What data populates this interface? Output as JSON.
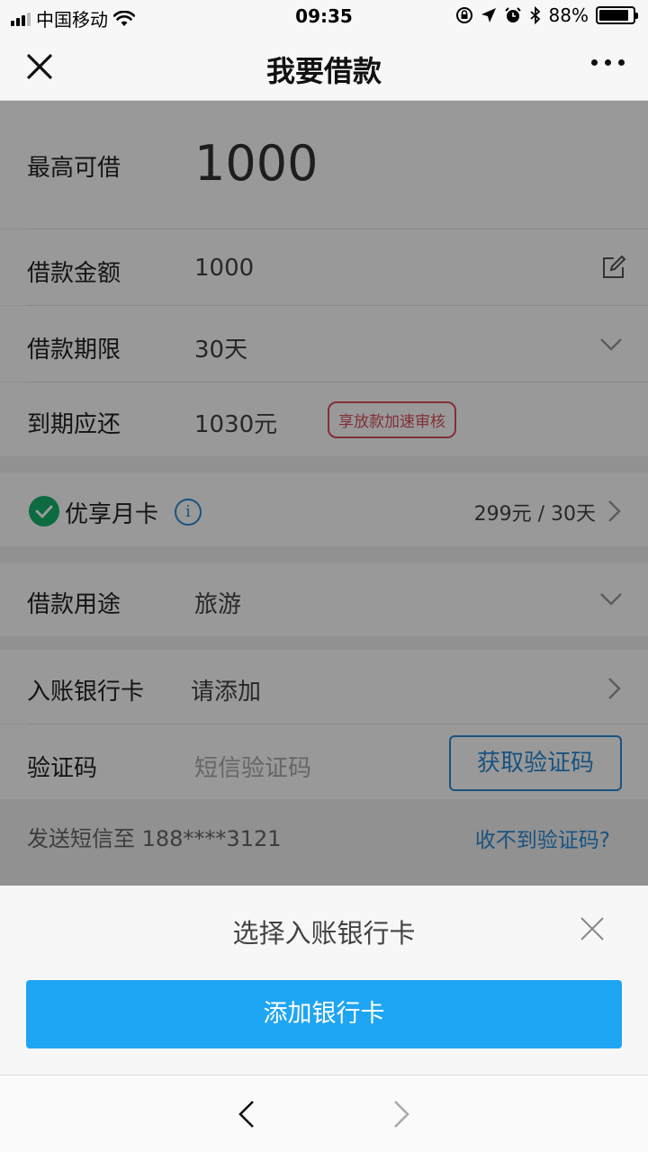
{
  "status": {
    "carrier": "中国移动",
    "time": "09:35",
    "battery": "88%",
    "battery_level": 0.88
  },
  "nav": {
    "title": "我要借款"
  },
  "form": {
    "max_label": "最高可借",
    "max_value": "1000",
    "amount_label": "借款金额",
    "amount_value": "1000",
    "term_label": "借款期限",
    "term_value": "30天",
    "repay_label": "到期应还",
    "repay_value": "1030元",
    "repay_tag": "享放款加速审核",
    "card_label": "优享月卡",
    "card_info_glyph": "i",
    "card_price": "299元 / 30天",
    "purpose_label": "借款用途",
    "purpose_value": "旅游",
    "bank_label": "入账银行卡",
    "bank_placeholder": "请添加",
    "code_label": "验证码",
    "code_placeholder": "短信验证码",
    "get_code_button": "获取验证码",
    "sms_hint": "发送短信至 188****3121",
    "no_code_link": "收不到验证码?"
  },
  "sheet": {
    "title": "选择入账银行卡",
    "add_card_button": "添加银行卡"
  },
  "colors": {
    "accent_blue": "#2a8ad6",
    "button_blue": "#1ea5f4",
    "tag_red": "#d9505c",
    "check_green": "#15b36b"
  }
}
